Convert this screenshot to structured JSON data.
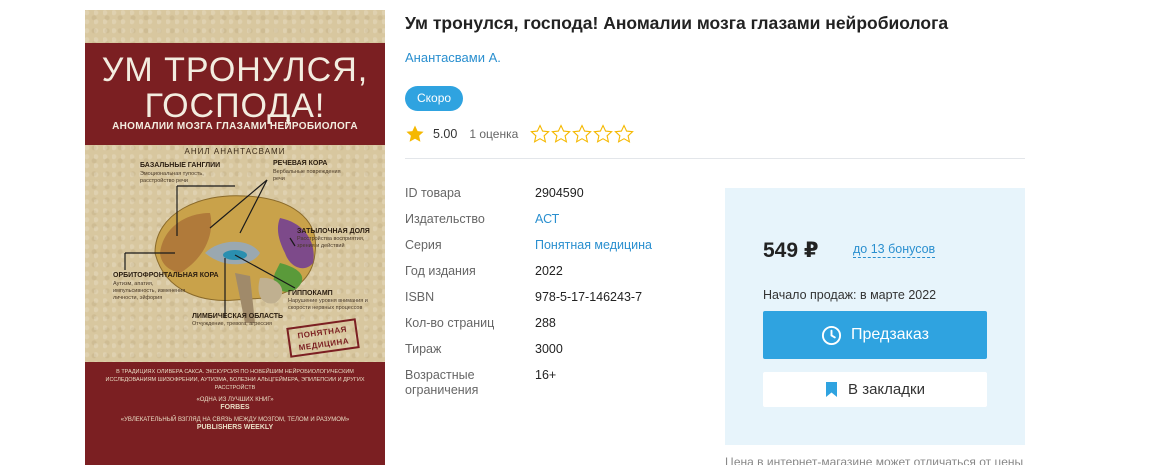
{
  "cover": {
    "title_line1": "УМ ТРОНУЛСЯ,",
    "title_line2": "ГОСПОДА!",
    "subtitle": "АНОМАЛИИ МОЗГА ГЛАЗАМИ НЕЙРОБИОЛОГА",
    "author": "АНИЛ АНАНТАСВАМИ",
    "labels": {
      "basal": "БАЗАЛЬНЫЕ ГАНГЛИИ",
      "basal_note": "Эмоциональная тупость, расстройство речи",
      "speech": "РЕЧЕВАЯ КОРА",
      "speech_note": "Вербальные повреждения речи",
      "occipital": "ЗАТЫЛОЧНАЯ ДОЛЯ",
      "occipital_note": "Расстройства восприятия, зрения и действий",
      "orbito": "ОРБИТОФРОНТАЛЬНАЯ КОРА",
      "orbito_note": "Аутизм, апатия, импульсивность, изменения личности, эйфория",
      "hippo": "ГИППОКАМП",
      "hippo_note": "Нарушение уровня внимания и скорости нервных процессов",
      "limbic": "ЛИМБИЧЕСКАЯ ОБЛАСТЬ",
      "limbic_note": "Отчуждение, тревога, агрессия"
    },
    "stamp_line1": "ПОНЯТНАЯ",
    "stamp_line2": "МЕДИЦИНА",
    "blurb": "В ТРАДИЦИЯХ ОЛИВЕРА САКСА. ЭКСКУРСИЯ ПО НОВЕЙШИМ НЕЙРОБИОЛОГИЧЕСКИМ ИССЛЕДОВАНИЯМ ШИЗОФРЕНИИ, АУТИЗМА, БОЛЕЗНИ АЛЬЦГЕЙМЕРА, ЭПИЛЕПСИИ И ДРУГИХ РАССТРОЙСТВ",
    "press1_quote": "«ОДНА ИЗ ЛУЧШИХ КНИГ»",
    "press1": "FORBES",
    "press2_quote": "«УВЛЕКАТЕЛЬНЫЙ ВЗГЛЯД НА СВЯЗЬ МЕЖДУ МОЗГОМ, ТЕЛОМ И РАЗУМОМ»",
    "press2": "PUBLISHERS WEEKLY"
  },
  "product": {
    "title": "Ум тронулся, господа! Аномалии мозга глазами нейробиолога",
    "author": "Анантасвами А.",
    "badge": "Скоро",
    "rating_value": "5.00",
    "rating_count": "1 оценка",
    "rating": 5,
    "rate_stars": 5
  },
  "specs": [
    {
      "key": "ID товара",
      "value": "2904590",
      "link": false
    },
    {
      "key": "Издательство",
      "value": "АСТ",
      "link": true
    },
    {
      "key": "Серия",
      "value": "Понятная медицина",
      "link": true
    },
    {
      "key": "Год издания",
      "value": "2022",
      "link": false
    },
    {
      "key": "ISBN",
      "value": "978-5-17-146243-7",
      "link": false
    },
    {
      "key": "Кол-во страниц",
      "value": "288",
      "link": false
    },
    {
      "key": "Тираж",
      "value": "3000",
      "link": false
    },
    {
      "key": "Возрастные ограничения",
      "value": "16+",
      "link": false
    }
  ],
  "buybox": {
    "price": "549 ₽",
    "bonus": "до 13 бонусов",
    "sale_start": "Начало продаж: в марте 2022",
    "preorder_label": "Предзаказ",
    "bookmark_label": "В закладки",
    "footnote": "Цена в интернет-магазине может отличаться от цены в"
  },
  "colors": {
    "accent": "#2fa3e0",
    "link": "#2a8fcf",
    "star": "#f5b800",
    "buybox_bg": "#e7f4fb",
    "cover_red": "#7b1f22"
  },
  "icons": {
    "rating": "star-filled-icon",
    "rate": "star-outline-icon",
    "preorder": "clock-icon",
    "bookmark": "bookmark-icon"
  }
}
